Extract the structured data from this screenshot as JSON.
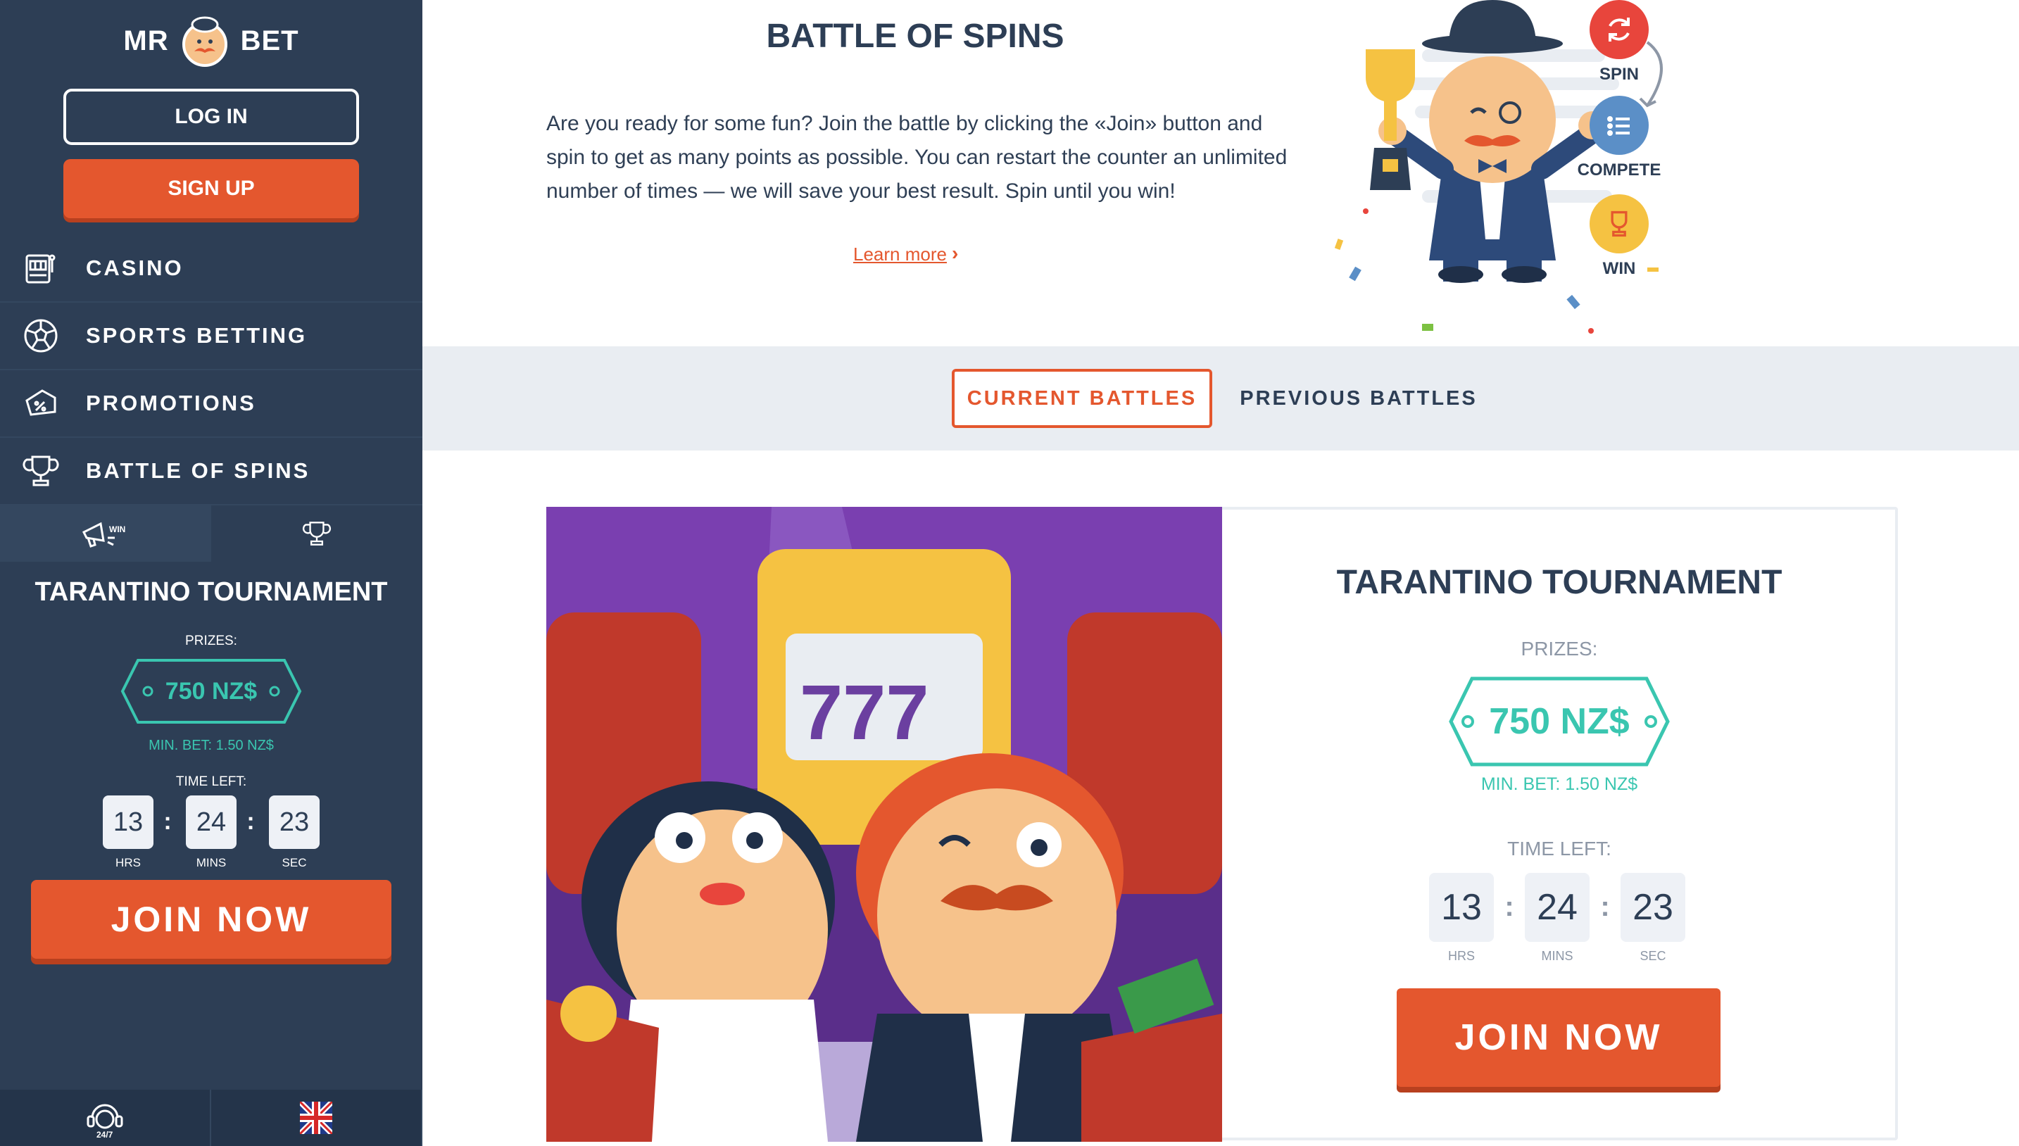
{
  "brand": {
    "left": "MR",
    "right": "BET",
    "accent": "#e4572e",
    "sidebar_bg": "#2d3e55",
    "teal": "#3ac6b0"
  },
  "auth": {
    "login_label": "LOG IN",
    "signup_label": "SIGN UP"
  },
  "nav": {
    "items": [
      {
        "label": "CASINO",
        "icon": "slot-machine-icon"
      },
      {
        "label": "SPORTS BETTING",
        "icon": "soccer-ball-icon"
      },
      {
        "label": "PROMOTIONS",
        "icon": "percent-ticket-icon"
      },
      {
        "label": "BATTLE OF SPINS",
        "icon": "trophy-icon"
      }
    ]
  },
  "side_tabs": [
    {
      "icon": "megaphone-win-icon",
      "active": true
    },
    {
      "icon": "trophy-icon",
      "active": false
    }
  ],
  "side_tournament": {
    "title": "TARANTINO TOURNAMENT",
    "prizes_label": "PRIZES:",
    "prize": "750 NZ$",
    "min_bet": "MIN. BET: 1.50 NZ$",
    "time_left_label": "TIME LEFT:",
    "hours": "13",
    "minutes": "24",
    "seconds": "23",
    "hrs_label": "HRS",
    "mins_label": "MINS",
    "sec_label": "SEC",
    "join_label": "JOIN NOW"
  },
  "footer": {
    "support_icon": "support-24-7-icon",
    "support_text": "24/7",
    "language_icon": "uk-flag-icon"
  },
  "page": {
    "title": "BATTLE OF SPINS",
    "description": "Are you ready for some fun? Join the battle by clicking the «Join» button and spin to get as many points as possible. You can restart the counter an unlimited number of times — we will save your best result. Spin until you win!",
    "learn_more": "Learn more",
    "steps": [
      {
        "label": "SPIN",
        "icon": "refresh-icon",
        "color": "#e8453c"
      },
      {
        "label": "COMPETE",
        "icon": "list-icon",
        "color": "#5b8fc7"
      },
      {
        "label": "WIN",
        "icon": "trophy-icon",
        "color": "#f5c242"
      }
    ]
  },
  "battle_tabs": {
    "current": "CURRENT BATTLES",
    "previous": "PREVIOUS BATTLES"
  },
  "tournament": {
    "title": "TARANTINO TOURNAMENT",
    "prizes_label": "PRIZES:",
    "prize": "750 NZ$",
    "min_bet": "MIN. BET: 1.50 NZ$",
    "time_left_label": "TIME LEFT:",
    "hours": "13",
    "minutes": "24",
    "seconds": "23",
    "hrs_label": "HRS",
    "mins_label": "MINS",
    "sec_label": "SEC",
    "join_label": "JOIN NOW",
    "slot_text": "777"
  }
}
